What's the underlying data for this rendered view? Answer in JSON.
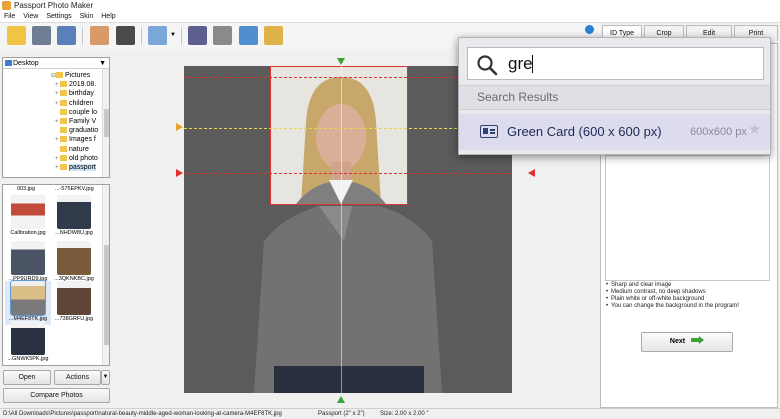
{
  "window": {
    "title": "Passport Photo Maker"
  },
  "menu": [
    "File",
    "View",
    "Settings",
    "Skin",
    "Help"
  ],
  "tabs": [
    {
      "label": "ID Type",
      "active": true
    },
    {
      "label": "Crop",
      "active": false
    },
    {
      "label": "Edit",
      "active": false
    },
    {
      "label": "Print",
      "active": false
    }
  ],
  "folder": {
    "root": "Desktop",
    "items": [
      {
        "label": "Pictures",
        "expanded": true
      },
      {
        "label": "2019.08."
      },
      {
        "label": "birthday"
      },
      {
        "label": "children"
      },
      {
        "label": "couple lo"
      },
      {
        "label": "Family V"
      },
      {
        "label": "graduatio"
      },
      {
        "label": "Images f"
      },
      {
        "label": "nature"
      },
      {
        "label": "old photo"
      },
      {
        "label": "passport"
      }
    ]
  },
  "thumbnails": {
    "top_captions": [
      "003.jpg",
      "...-575EPKV.jpg"
    ],
    "items": [
      {
        "caption": "Calibration.jpg",
        "tone": "#c24a3a"
      },
      {
        "caption": "...NHDW8U.jpg",
        "tone": "#2f3a4a"
      },
      {
        "caption": "...PP9URD9.jpg",
        "tone": "#4a5464"
      },
      {
        "caption": "...3QKNKBC.jpg",
        "tone": "#7a5a3a"
      },
      {
        "caption": "...M4EF8TK.jpg",
        "tone": "#b8a170",
        "selected": true
      },
      {
        "caption": "...738GRFU.jpg",
        "tone": "#5e4538"
      },
      {
        "caption": "...GNWK5PK.jpg",
        "tone": "#2a3242"
      }
    ]
  },
  "buttons": {
    "open": "Open",
    "actions": "Actions",
    "compare": "Compare Photos",
    "next": "Next"
  },
  "search": {
    "query": "gre",
    "results_heading": "Search Results",
    "results": [
      {
        "label": "Green Card (600 x 600 px)",
        "size": "600x600 px"
      }
    ]
  },
  "requirements": [
    "Sharp and clear image",
    "Medium contrast, no deep shadows",
    "Plain white or off-white background",
    "You can change the background in the program!"
  ],
  "status": {
    "path": "D:\\All Downloads\\Pictures\\passport\\natural-beauty-middle-aged-woman-looking-at-camera-M4EF8TK.jpg",
    "format": "Passport (2\" x 2\")",
    "size": "Size: 2.00 x 2.00 \""
  }
}
